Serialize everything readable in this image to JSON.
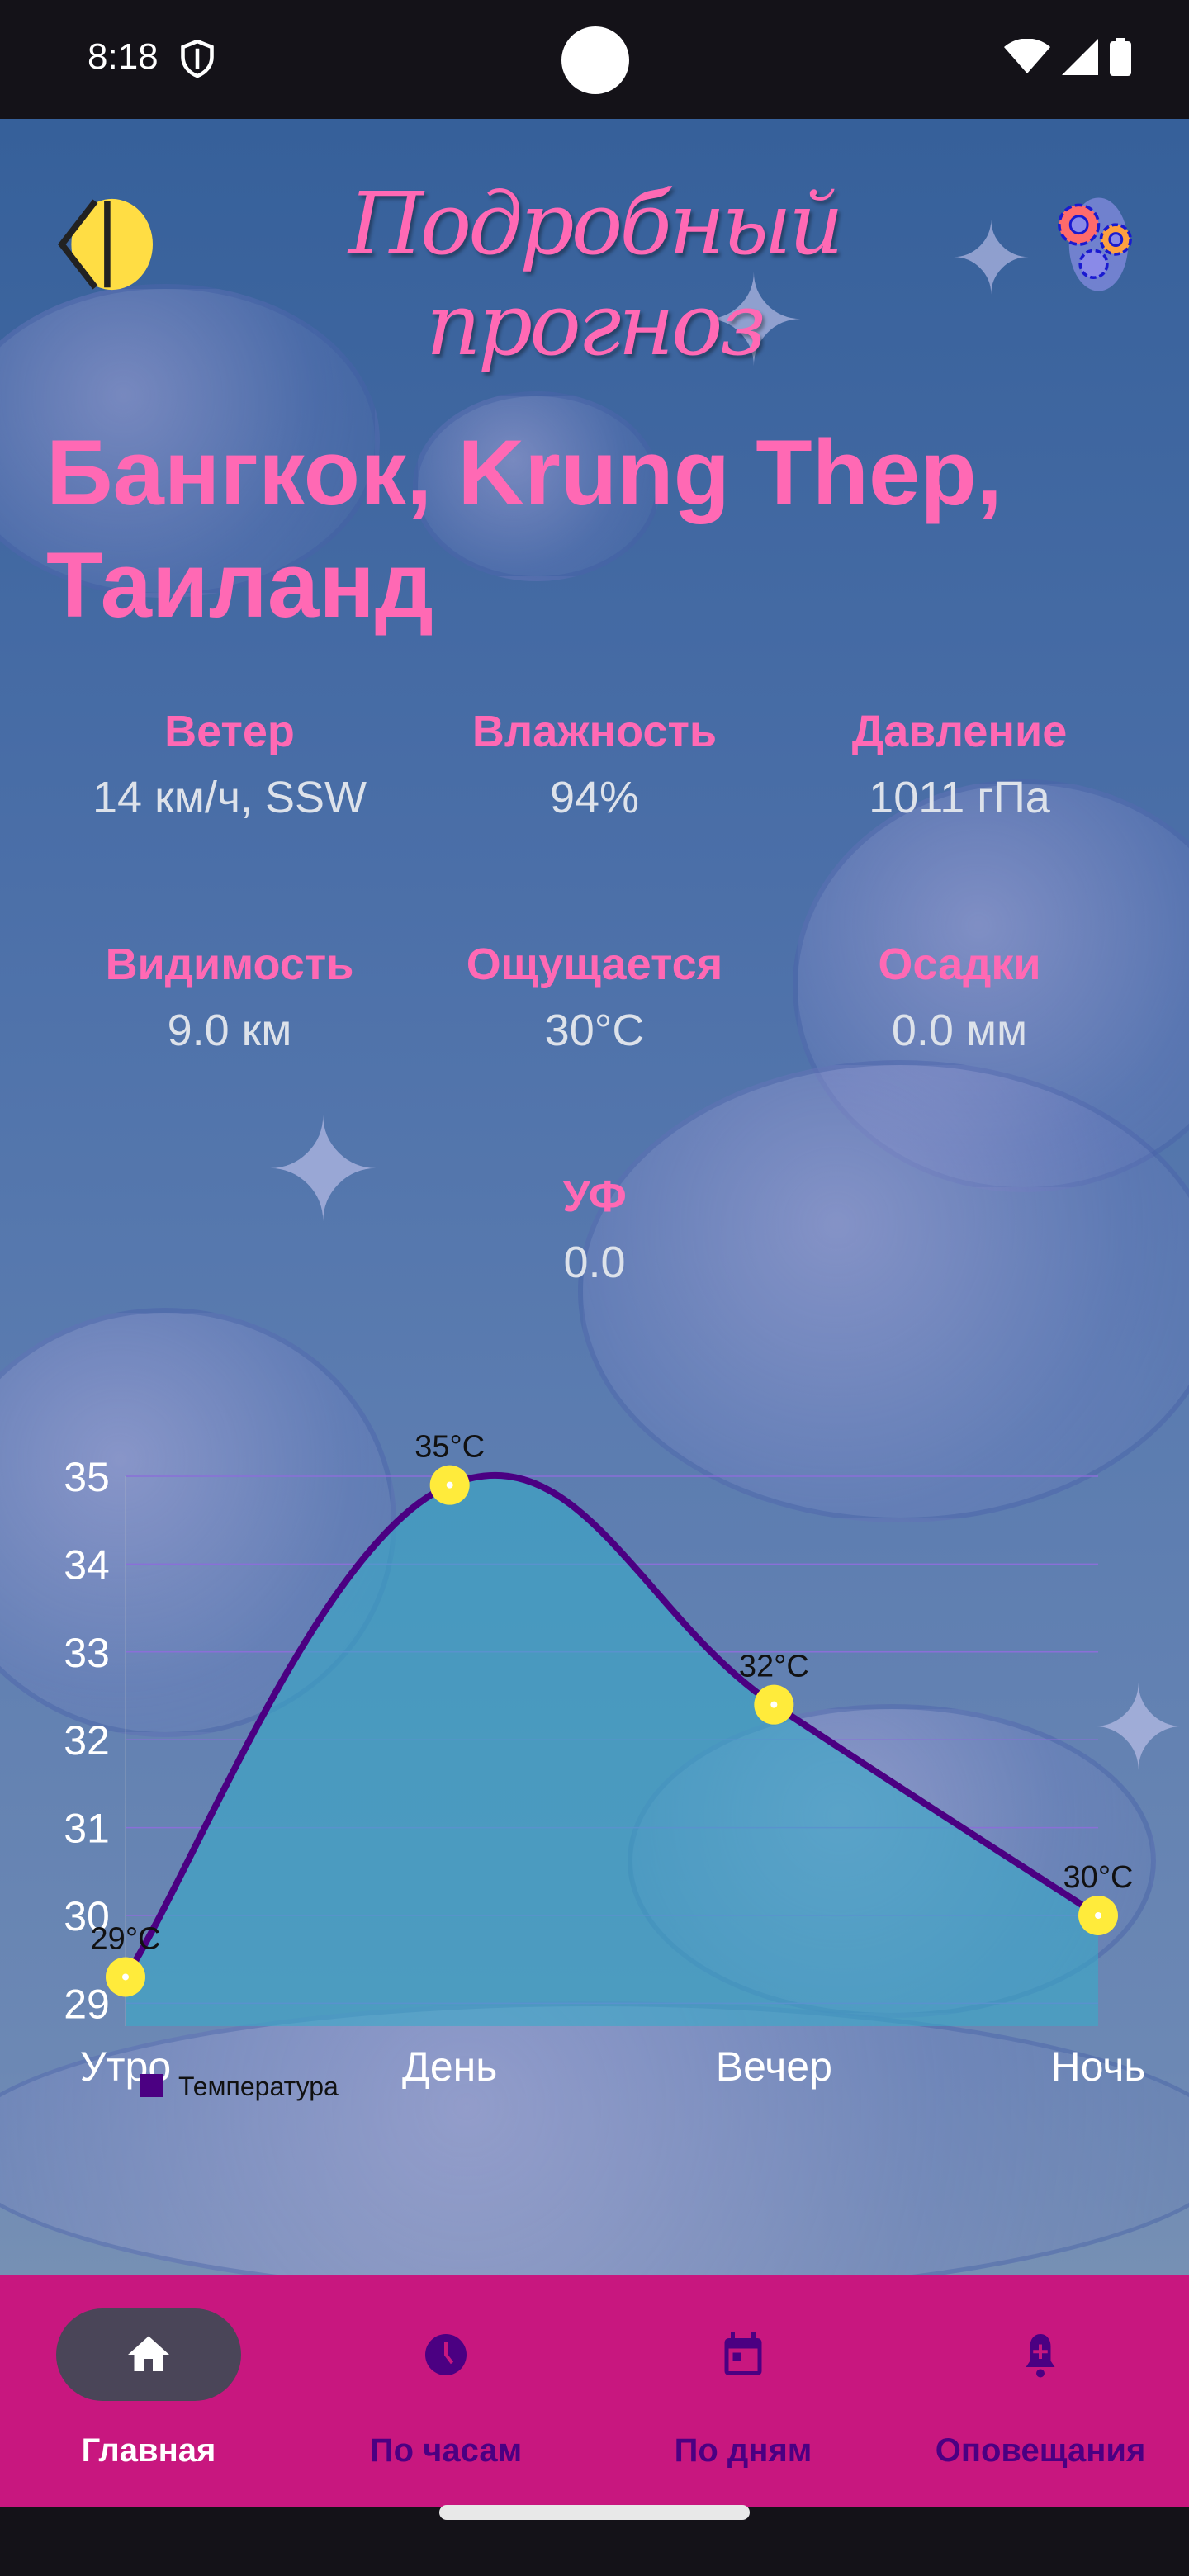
{
  "status_bar": {
    "time": "8:18"
  },
  "header": {
    "title": "Подробный прогноз"
  },
  "location": {
    "city": "Бангкок, Krung Thep, Таиланд"
  },
  "stats": [
    {
      "label": "Ветер",
      "value": "14 км/ч, SSW"
    },
    {
      "label": "Влажность",
      "value": "94%"
    },
    {
      "label": "Давление",
      "value": "1011 гПа"
    },
    {
      "label": "Видимость",
      "value": "9.0 км"
    },
    {
      "label": "Ощущается",
      "value": "30°C"
    },
    {
      "label": "Осадки",
      "value": "0.0 мм"
    },
    {
      "label": "УФ",
      "value": "0.0"
    }
  ],
  "chart_data": {
    "type": "line",
    "categories": [
      "Утро",
      "День",
      "Вечер",
      "Ночь"
    ],
    "series": [
      {
        "name": "Температура",
        "values": [
          29.3,
          34.9,
          32.4,
          30.0
        ],
        "labels": [
          "29°C",
          "35°C",
          "32°C",
          "30°C"
        ],
        "color": "#4b0082"
      }
    ],
    "yticks": [
      29,
      30,
      31,
      32,
      33,
      34,
      35
    ],
    "ylim": [
      28.5,
      35
    ],
    "fill": true,
    "grid": true,
    "legend": "bottom-left",
    "point_color": "#ffeb3b"
  },
  "nav": {
    "items": [
      {
        "label": "Главная",
        "active": true
      },
      {
        "label": "По часам"
      },
      {
        "label": "По дням"
      },
      {
        "label": "Оповещания"
      }
    ]
  },
  "colors": {
    "accent": "#ff69b4",
    "nav_bg": "#c8177f",
    "nav_fg": "#4b0082"
  }
}
